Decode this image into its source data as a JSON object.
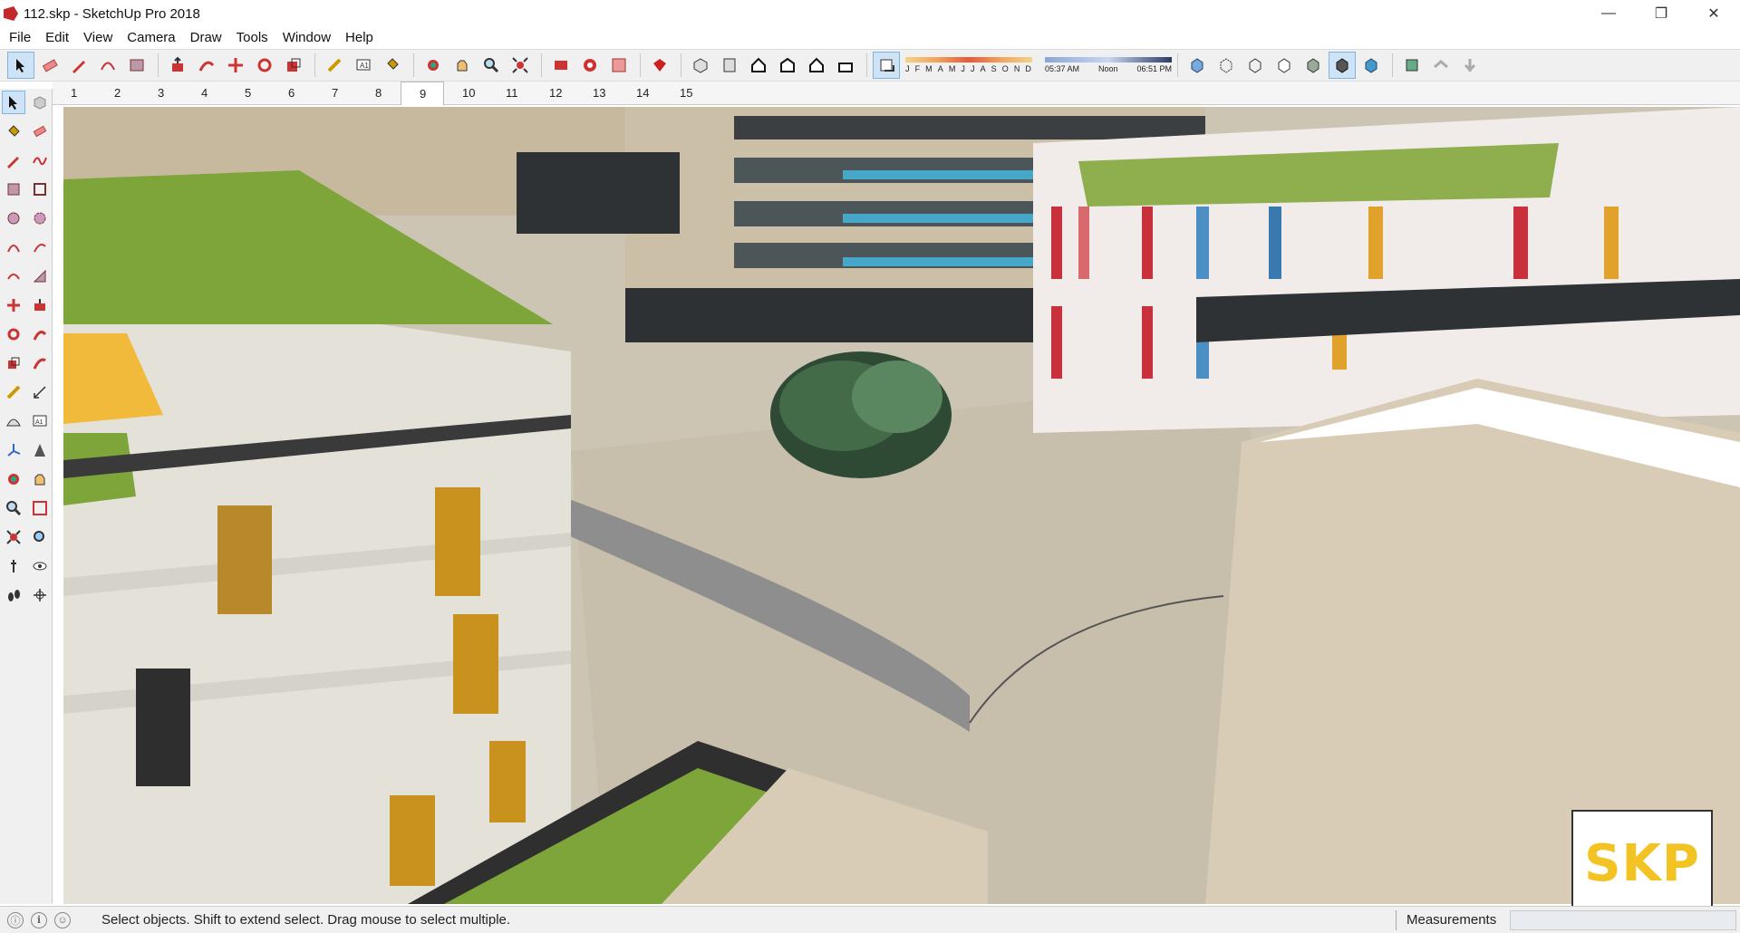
{
  "window": {
    "title": "112.skp - SketchUp Pro 2018",
    "controls": [
      "minimize-icon",
      "restore-icon",
      "close-icon"
    ]
  },
  "menu": [
    "File",
    "Edit",
    "View",
    "Camera",
    "Draw",
    "Tools",
    "Window",
    "Help"
  ],
  "toolbar": {
    "tools": [
      "select-icon",
      "eraser-icon",
      "pencil-icon",
      "arc-icon",
      "rectangle-icon",
      "push-pull-icon",
      "follow-me-icon",
      "move-icon",
      "rotate-icon",
      "scale-icon",
      "tape-measure-icon",
      "text-icon",
      "paint-bucket-icon",
      "orbit-icon",
      "pan-icon",
      "zoom-icon",
      "zoom-extents-icon",
      "3d-warehouse-icon",
      "extension-warehouse-icon",
      "layout-icon",
      "ruby-icon",
      "iso-view-icon",
      "top-view-icon",
      "front-view-icon",
      "right-view-icon",
      "back-view-icon",
      "left-view-icon",
      "shadows-toggle-icon"
    ],
    "shadows": {
      "months": [
        "J",
        "F",
        "M",
        "A",
        "M",
        "J",
        "J",
        "A",
        "S",
        "O",
        "N",
        "D"
      ],
      "time_start": "05:37 AM",
      "time_noon": "Noon",
      "time_end": "06:51 PM"
    },
    "styles": [
      "xray-icon",
      "back-edges-icon",
      "wireframe-icon",
      "hidden-line-icon",
      "shaded-icon",
      "shaded-textures-icon",
      "monochrome-icon",
      "section-plane-icon",
      "section-display-icon",
      "section-cut-icon"
    ]
  },
  "scene_tabs": [
    "1",
    "2",
    "3",
    "4",
    "5",
    "6",
    "7",
    "8",
    "9",
    "10",
    "11",
    "12",
    "13",
    "14",
    "15"
  ],
  "active_scene": "9",
  "left_tools": [
    "select-icon",
    "make-component-icon",
    "paint-bucket-icon",
    "eraser-icon",
    "pencil-icon",
    "freehand-icon",
    "rectangle-icon",
    "rotated-rectangle-icon",
    "circle-icon",
    "polygon-icon",
    "arc-icon",
    "2point-arc-icon",
    "3point-arc-icon",
    "pie-icon",
    "move-icon",
    "push-pull-icon",
    "rotate-icon",
    "follow-me-icon",
    "scale-icon",
    "offset-icon",
    "tape-measure-icon",
    "dimension-icon",
    "protractor-icon",
    "text-icon",
    "axes-icon",
    "3d-text-icon",
    "orbit-icon",
    "pan-icon",
    "zoom-icon",
    "zoom-window-icon",
    "zoom-extents-icon",
    "previous-view-icon",
    "position-camera-icon",
    "look-around-icon",
    "walk-icon",
    "section-plane-icon"
  ],
  "status": {
    "message": "Select objects. Shift to extend select. Drag mouse to select multiple.",
    "measurements_label": "Measurements",
    "measurements_value": ""
  },
  "watermark": "SKP",
  "colors": {
    "lawn": "#7aa33a",
    "paving": "#c9c2b3",
    "stone_facade": "#d8ccb6",
    "accent_yellow": "#f3c223"
  }
}
